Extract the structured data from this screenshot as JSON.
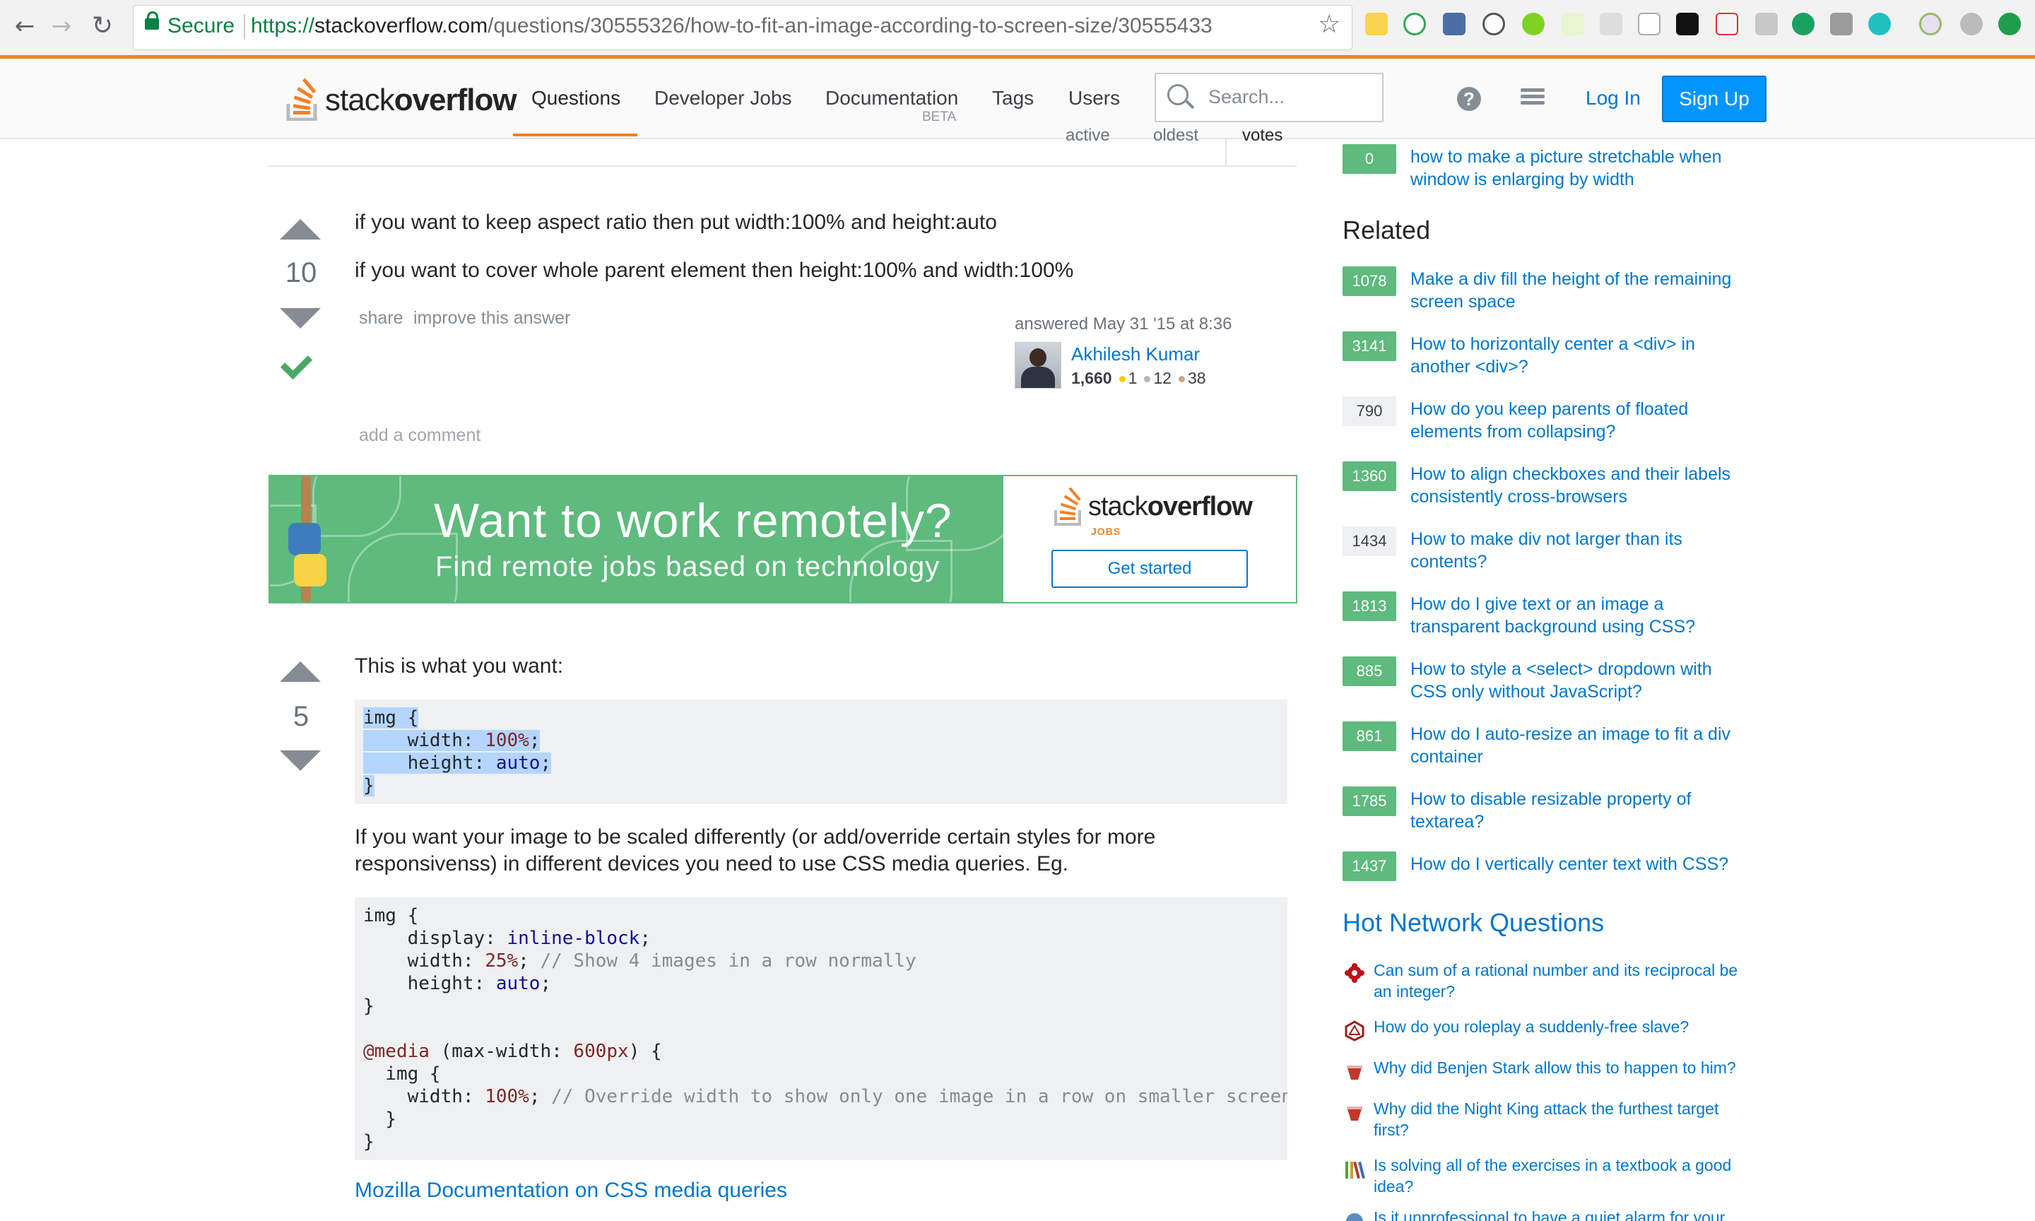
{
  "browser": {
    "secure_label": "Secure",
    "url_scheme": "https://",
    "url_host": "stackoverflow.com",
    "url_path": "/questions/30555326/how-to-fit-an-image-according-to-screen-size/30555433"
  },
  "topbar": {
    "logo_light": "stack",
    "logo_bold": "overflow",
    "nav": [
      "Questions",
      "Developer Jobs",
      "Documentation",
      "Tags",
      "Users"
    ],
    "doc_badge": "BETA",
    "search_placeholder": "Search...",
    "help_symbol": "?",
    "login": "Log In",
    "signup": "Sign Up"
  },
  "sort_tabs": [
    "active",
    "oldest",
    "votes"
  ],
  "answer1": {
    "votes": "10",
    "line1": "if you want to keep aspect ratio then put width:100% and height:auto",
    "line2": "if you want to cover whole parent element then height:100% and width:100%",
    "share": "share",
    "improve": "improve this answer",
    "answered": "answered May 31 '15 at 8:36",
    "user_name": "Akhilesh Kumar",
    "user_rep": "1,660",
    "gold": "1",
    "silver": "12",
    "bronze": "38",
    "add_comment": "add a comment"
  },
  "banner": {
    "headline": "Want to work remotely?",
    "subline": "Find remote jobs based on technology",
    "logo_light": "stack",
    "logo_bold": "overflow",
    "logo_sub": "JOBS",
    "button": "Get started"
  },
  "answer2": {
    "votes": "5",
    "intro": "This is what you want:",
    "para_line1": "If you want your image to be scaled differently (or add/override certain styles for more",
    "para_line2": "responsivenss) in different devices you need to use CSS media queries. Eg.",
    "link": "Mozilla Documentation on CSS media queries"
  },
  "sidebar": {
    "top_item": {
      "score": "0",
      "line1": "how to make a picture stretchable when",
      "line2": "window is enlarging by width"
    },
    "related_heading": "Related",
    "related": [
      {
        "score": "1078",
        "accepted": true,
        "line1": "Make a div fill the height of the remaining",
        "line2": "screen space"
      },
      {
        "score": "3141",
        "accepted": true,
        "line1": "How to horizontally center a <div> in",
        "line2": "another <div>?"
      },
      {
        "score": "790",
        "accepted": false,
        "line1": "How do you keep parents of floated",
        "line2": "elements from collapsing?"
      },
      {
        "score": "1360",
        "accepted": true,
        "line1": "How to align checkboxes and their labels",
        "line2": "consistently cross-browsers"
      },
      {
        "score": "1434",
        "accepted": false,
        "line1": "How to make div not larger than its",
        "line2": "contents?"
      },
      {
        "score": "1813",
        "accepted": true,
        "line1": "How do I give text or an image a",
        "line2": "transparent background using CSS?"
      },
      {
        "score": "885",
        "accepted": true,
        "line1": "How to style a <select> dropdown with",
        "line2": "CSS only without JavaScript?"
      },
      {
        "score": "861",
        "accepted": true,
        "line1": "How do I auto-resize an image to fit a div",
        "line2": "container"
      },
      {
        "score": "1785",
        "accepted": true,
        "line1": "How to disable resizable property of",
        "line2": "textarea?"
      },
      {
        "score": "1437",
        "accepted": true,
        "line1": "How do I vertically center text with CSS?",
        "line2": ""
      }
    ],
    "hnq_heading": "Hot Network Questions",
    "hnq": [
      {
        "icon": "math-site-icon",
        "line1": "Can sum of a rational number and its reciprocal be",
        "line2": "an integer?"
      },
      {
        "icon": "rpg-site-icon",
        "line1": "How do you roleplay a suddenly-free slave?",
        "line2": ""
      },
      {
        "icon": "scifi-site-icon",
        "line1": "Why did Benjen Stark allow this to happen to him?",
        "line2": ""
      },
      {
        "icon": "scifi-site-icon",
        "line1": "Why did the Night King attack the furthest target",
        "line2": "first?"
      },
      {
        "icon": "academia-site-icon",
        "line1": "Is solving all of the exercises in a textbook a good",
        "line2": "idea?"
      },
      {
        "icon": "workplace-site-icon",
        "line1": "Is it unprofessional to have a quiet alarm for your",
        "line2": ""
      }
    ]
  },
  "colors": {
    "accent": "#f48024",
    "link": "#0077cc",
    "accepted": "#5eba7d"
  }
}
